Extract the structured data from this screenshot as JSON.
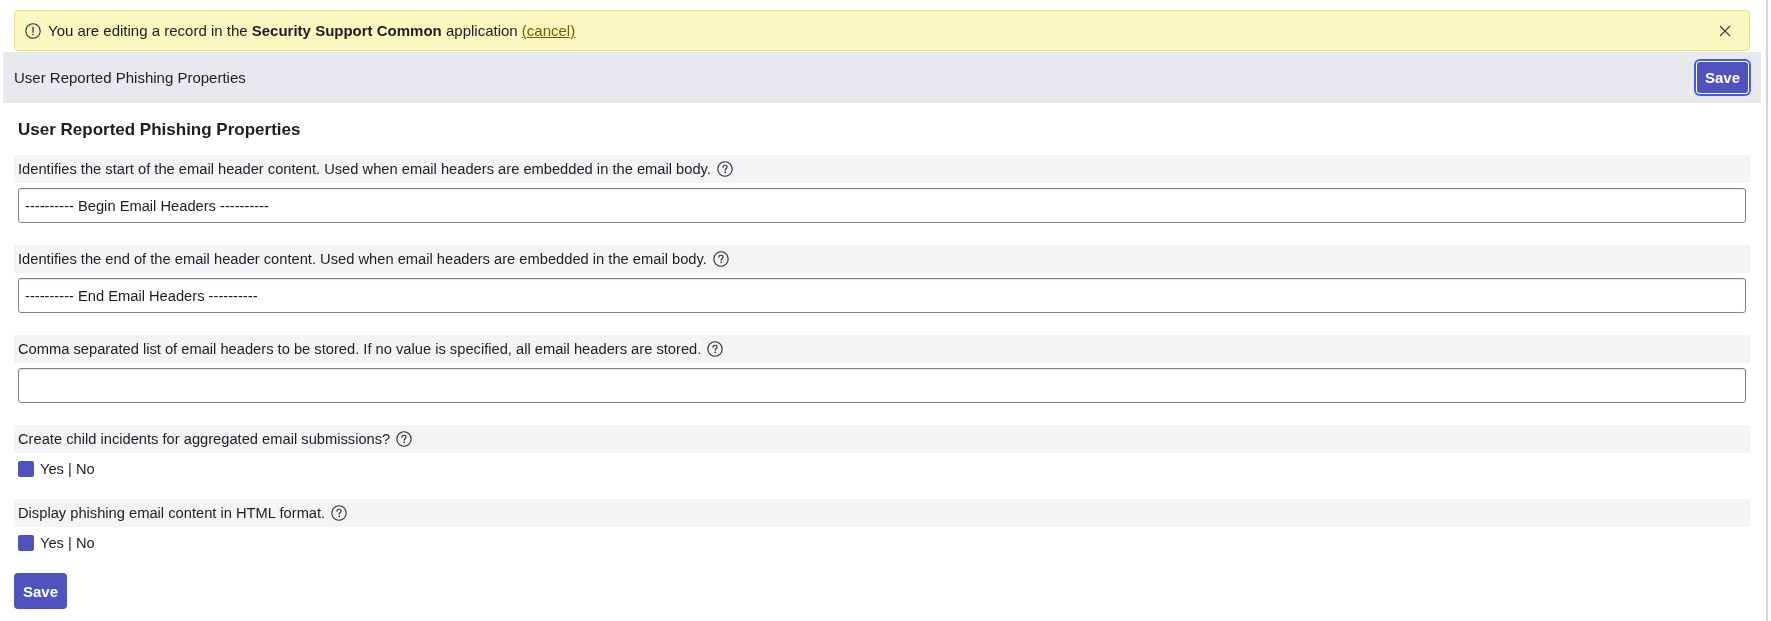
{
  "banner": {
    "message": "You are editing a record in the **Security Support Common** application",
    "cancel_link": "(cancel)"
  },
  "header": {
    "title": "User Reported Phishing Properties",
    "save_button": {
      "label": "Save",
      "focused": true
    }
  },
  "form": {
    "heading": "User Reported Phishing Properties",
    "fields": [
      {
        "kind": "text",
        "label": "Identifies the start of the email header content. Used when email headers are embedded in the email body.",
        "value": "---------- Begin Email Headers ----------"
      },
      {
        "kind": "text",
        "label": "Identifies the end of the email header content. Used when email headers are embedded in the email body.",
        "value": "---------- End Email Headers ----------"
      },
      {
        "kind": "text",
        "label": "Comma separated list of email headers to be stored. If no value is specified, all email headers are stored."
      },
      {
        "kind": "checkbox",
        "label": "Create child incidents for aggregated email submissions?",
        "option": "Yes | No",
        "checked": true
      },
      {
        "kind": "checkbox",
        "label": "Display phishing email content in HTML format.",
        "option": "Yes | No",
        "checked": true
      }
    ],
    "save_button": {
      "label": "Save",
      "focused": false
    }
  }
}
